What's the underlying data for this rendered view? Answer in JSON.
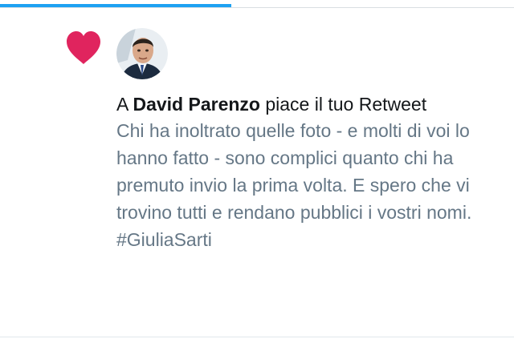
{
  "progress": {
    "fraction": 0.45
  },
  "colors": {
    "accent": "#1da1f2",
    "like": "#e0245e",
    "text_primary": "#14171a",
    "text_secondary": "#657786"
  },
  "notification": {
    "icon": "heart-icon",
    "avatar": "user-avatar",
    "prefix": "A ",
    "user_name": "David Parenzo",
    "action_text": " piace il tuo Retweet",
    "tweet_text": "Chi ha inoltrato quelle foto - e molti di voi lo hanno fatto -  sono complici quanto chi ha premuto invio la prima volta. E spero che vi trovino tutti e rendano pubblici i vostri nomi. #GiuliaSarti"
  }
}
